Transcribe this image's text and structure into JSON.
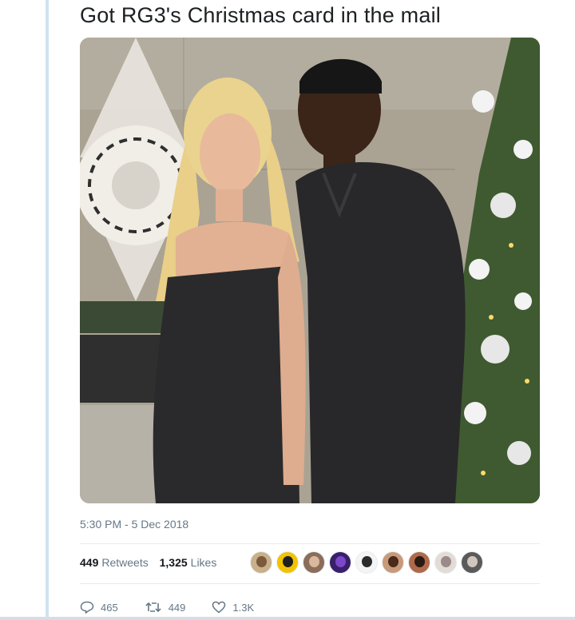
{
  "tweet": {
    "text": "Got RG3's Christmas card in the mail",
    "timestamp": "5:30 PM - 5 Dec 2018"
  },
  "stats": {
    "retweets_count": "449",
    "retweets_label": "Retweets",
    "likes_count": "1,325",
    "likes_label": "Likes"
  },
  "liked_by_avatars": [
    {
      "bg": "#c9b08a",
      "head": "#7a5a3a"
    },
    {
      "bg": "#f2c200",
      "head": "#1f1f1f"
    },
    {
      "bg": "#8c6d5a",
      "head": "#d9b8a0"
    },
    {
      "bg": "#3a1f6a",
      "head": "#7a48c8"
    },
    {
      "bg": "#f4f4f4",
      "head": "#2b2b2b"
    },
    {
      "bg": "#c89a7a",
      "head": "#4a2a1a"
    },
    {
      "bg": "#b06a4a",
      "head": "#2a1a14"
    },
    {
      "bg": "#e3dcd5",
      "head": "#9a8a8a"
    },
    {
      "bg": "#5a5a5a",
      "head": "#d0c6bd"
    }
  ],
  "actions": {
    "reply_count": "465",
    "retweet_count": "449",
    "like_count": "1.3K"
  },
  "colors": {
    "accent_rule": "#cfe3ef",
    "meta_text": "#657786",
    "body_text": "#1c2022"
  }
}
